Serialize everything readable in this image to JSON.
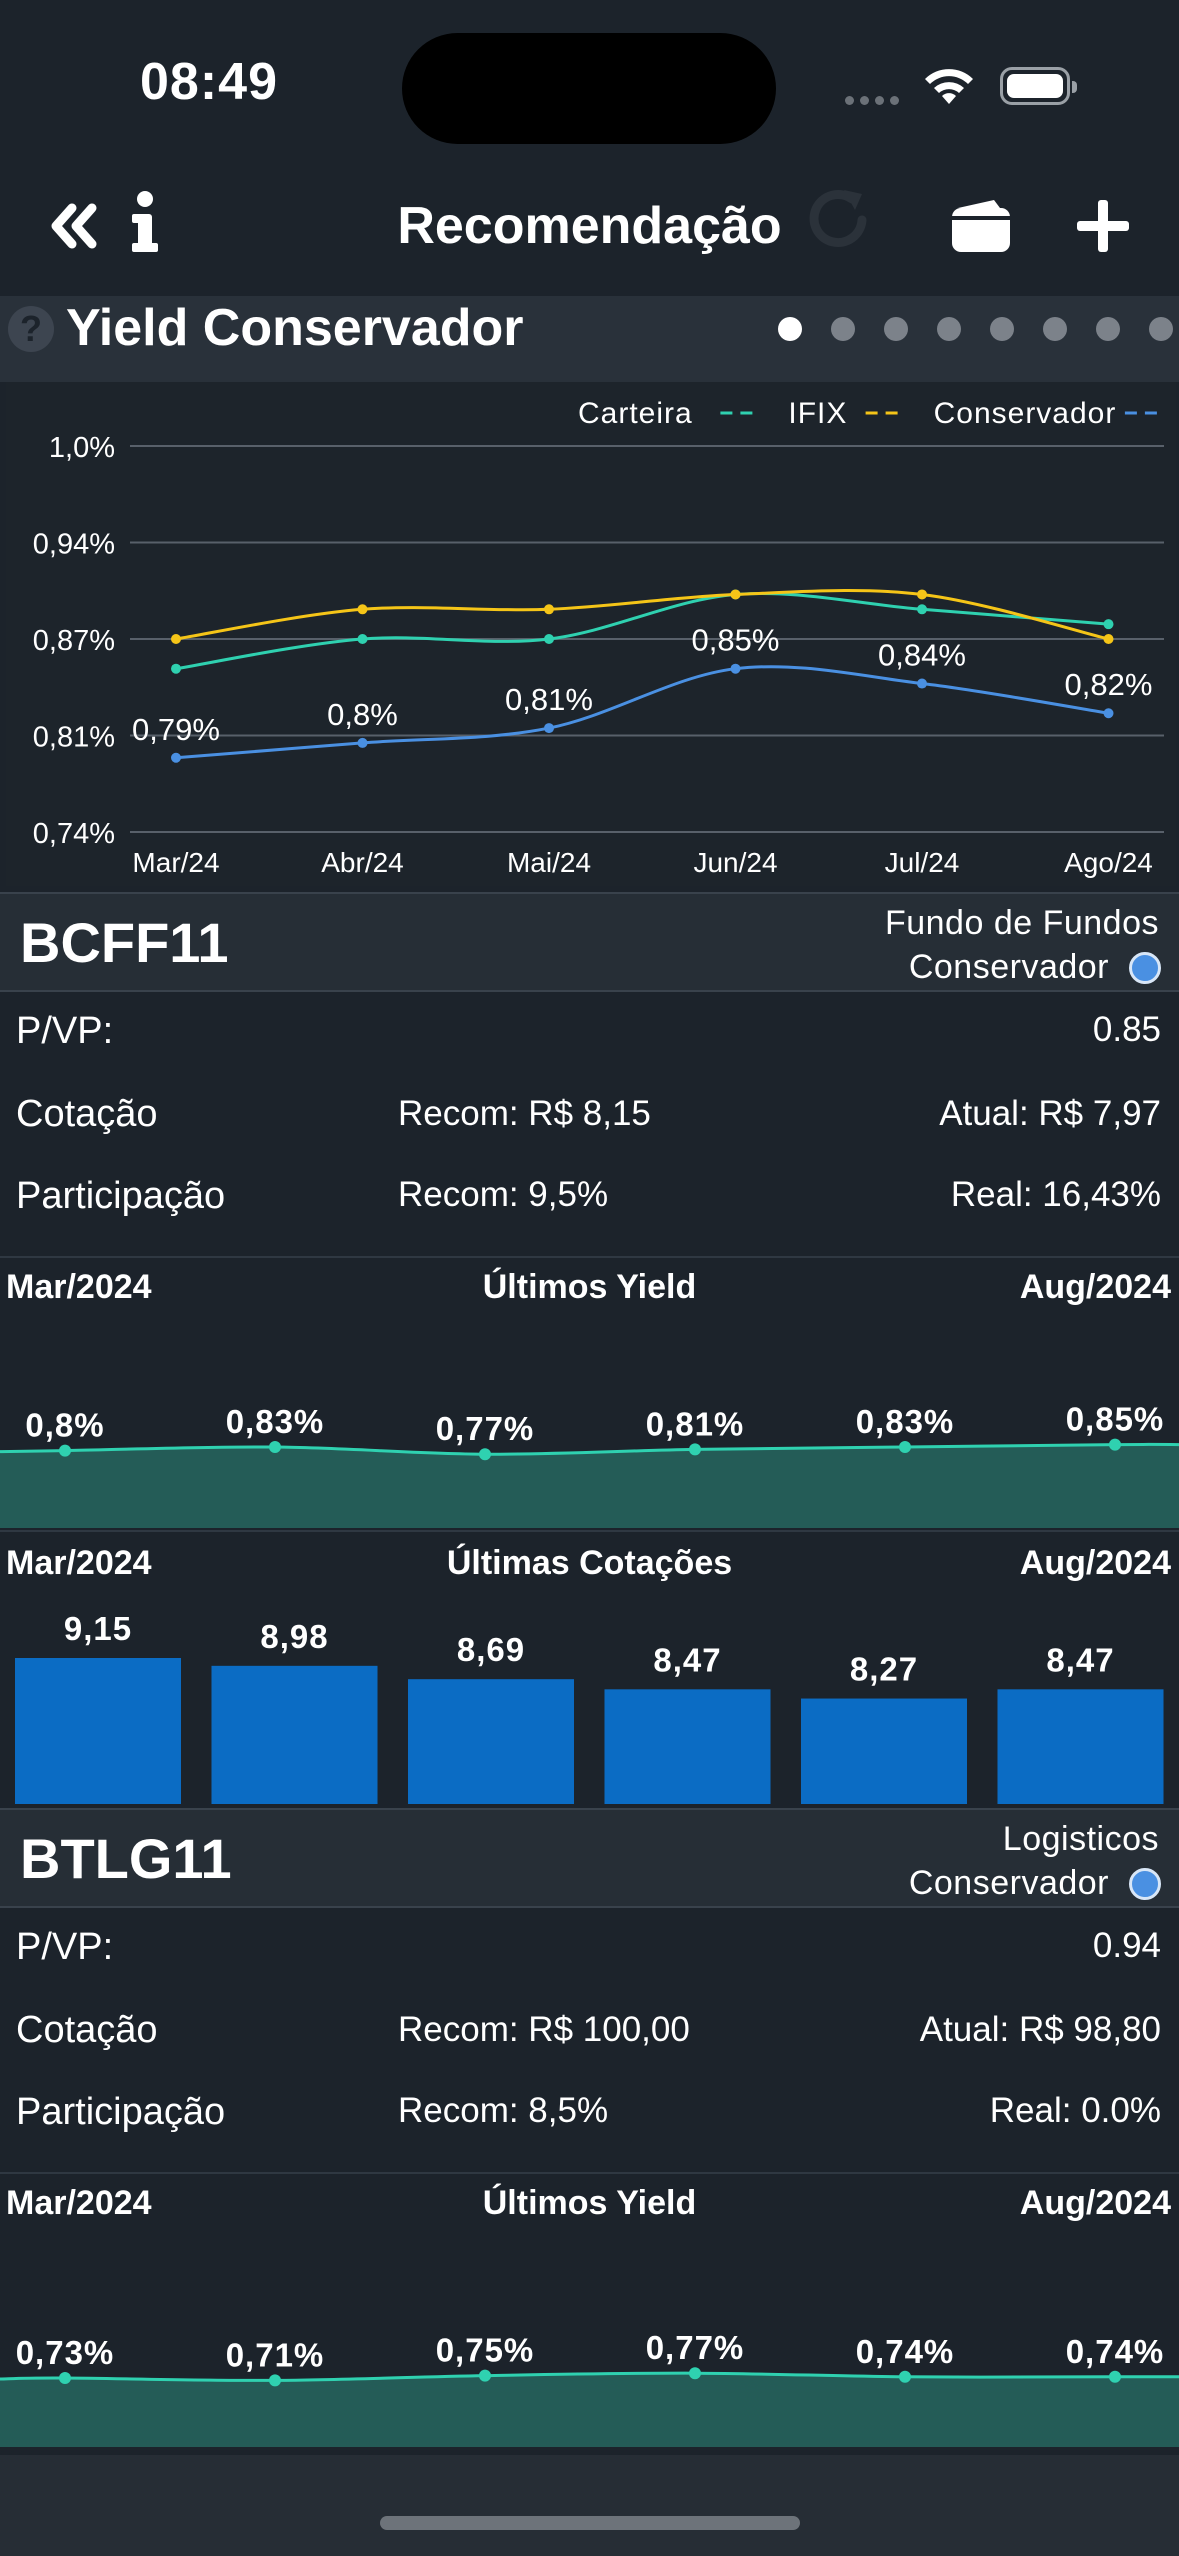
{
  "status_bar": {
    "time": "08:49"
  },
  "nav": {
    "title": "Recomendação"
  },
  "section": {
    "title": "Yield Conservador",
    "page_count": 8,
    "active_page": 0
  },
  "chart_data": {
    "type": "line",
    "categories": [
      "Mar/24",
      "Abr/24",
      "Mai/24",
      "Jun/24",
      "Jul/24",
      "Ago/24"
    ],
    "y_ticks": [
      "1,0%",
      "0,94%",
      "0,87%",
      "0,81%",
      "0,74%"
    ],
    "ylim": [
      0.74,
      1.0
    ],
    "legend_position": "top-right",
    "series": [
      {
        "name": "Carteira",
        "color": "#2fd1b0",
        "values": [
          0.85,
          0.87,
          0.87,
          0.9,
          0.89,
          0.88
        ]
      },
      {
        "name": "IFIX",
        "color": "#f5c518",
        "values": [
          0.87,
          0.89,
          0.89,
          0.9,
          0.9,
          0.87
        ]
      },
      {
        "name": "Conservador",
        "color": "#4a90e2",
        "values": [
          0.79,
          0.8,
          0.81,
          0.85,
          0.84,
          0.82
        ],
        "labels": [
          "0,79%",
          "0,8%",
          "0,81%",
          "0,85%",
          "0,84%",
          "0,82%"
        ]
      }
    ]
  },
  "funds": [
    {
      "ticker": "BCFF11",
      "type": "Fundo de Fundos",
      "profile": "Conservador",
      "pvp_label": "P/VP:",
      "pvp": "0.85",
      "cotacao_label": "Cotação",
      "cotacao_recom": "Recom: R$ 8,15",
      "cotacao_atual": "Atual: R$ 7,97",
      "part_label": "Participação",
      "part_recom": "Recom: 9,5%",
      "part_real": "Real: 16,43%",
      "yield_chart": {
        "title": "Últimos Yield",
        "start": "Mar/2024",
        "end": "Aug/2024",
        "values": [
          0.8,
          0.83,
          0.77,
          0.81,
          0.83,
          0.85
        ],
        "labels": [
          "0,8%",
          "0,83%",
          "0,77%",
          "0,81%",
          "0,83%",
          "0,85%"
        ]
      },
      "price_chart": {
        "title": "Últimas Cotações",
        "start": "Mar/2024",
        "end": "Aug/2024",
        "values": [
          9.15,
          8.98,
          8.69,
          8.47,
          8.27,
          8.47
        ],
        "labels": [
          "9,15",
          "8,98",
          "8,69",
          "8,47",
          "8,27",
          "8,47"
        ]
      }
    },
    {
      "ticker": "BTLG11",
      "type": "Logisticos",
      "profile": "Conservador",
      "pvp_label": "P/VP:",
      "pvp": "0.94",
      "cotacao_label": "Cotação",
      "cotacao_recom": "Recom: R$ 100,00",
      "cotacao_atual": "Atual: R$ 98,80",
      "part_label": "Participação",
      "part_recom": "Recom: 8,5%",
      "part_real": "Real: 0.0%",
      "yield_chart": {
        "title": "Últimos Yield",
        "start": "Mar/2024",
        "end": "Aug/2024",
        "values": [
          0.73,
          0.71,
          0.75,
          0.77,
          0.74,
          0.74
        ],
        "labels": [
          "0,73%",
          "0,71%",
          "0,75%",
          "0,77%",
          "0,74%",
          "0,74%"
        ]
      }
    }
  ],
  "colors": {
    "background": "#1c232b",
    "accent_teal": "#2fd1b0",
    "area_fill": "#245c57",
    "bar_blue": "#0b6cc4",
    "profile_blue": "#4a90e2"
  },
  "icons": [
    "back-double-chevron-icon",
    "info-icon",
    "refresh-icon",
    "wallet-icon",
    "plus-icon",
    "help-icon",
    "wifi-icon",
    "battery-icon"
  ]
}
